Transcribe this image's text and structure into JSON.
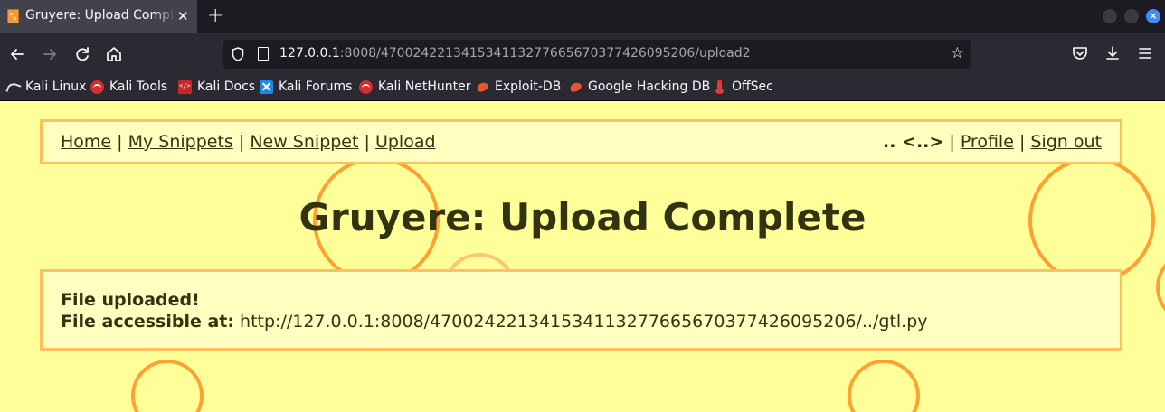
{
  "browser": {
    "tab_title": "Gruyere: Upload Complete",
    "close_glyph": "✕",
    "new_tab_glyph": "+",
    "url_host": "127.0.0.1",
    "url_rest": ":8008/470024221341534113277665670377426095206/upload2",
    "bookmarks": [
      {
        "label": "Kali Linux",
        "icon": "kali-dragon-icon"
      },
      {
        "label": "Kali Tools",
        "icon": "kali-tools-icon"
      },
      {
        "label": "Kali Docs",
        "icon": "kali-docs-icon"
      },
      {
        "label": "Kali Forums",
        "icon": "kali-forums-icon"
      },
      {
        "label": "Kali NetHunter",
        "icon": "kali-nethunter-icon"
      },
      {
        "label": "Exploit-DB",
        "icon": "exploit-db-icon"
      },
      {
        "label": "Google Hacking DB",
        "icon": "ghdb-icon"
      },
      {
        "label": "OffSec",
        "icon": "offsec-icon"
      }
    ]
  },
  "menu": {
    "home": "Home",
    "my_snippets": "My Snippets",
    "new_snippet": "New Snippet",
    "upload": "Upload",
    "separator": "|",
    "user": ".. <..>",
    "profile": "Profile",
    "sign_out": "Sign out"
  },
  "page": {
    "title": "Gruyere: Upload Complete",
    "line1": "File uploaded!",
    "line2_label": "File accessible at:",
    "line2_value": "http://127.0.0.1:8008/470024221341534113277665670377426095206/../gtl.py"
  },
  "colors": {
    "page_background": "#ffff99",
    "box_background": "#ffffbf",
    "box_border": "#ffc060",
    "circle": "#ffa033",
    "text": "#333311"
  }
}
